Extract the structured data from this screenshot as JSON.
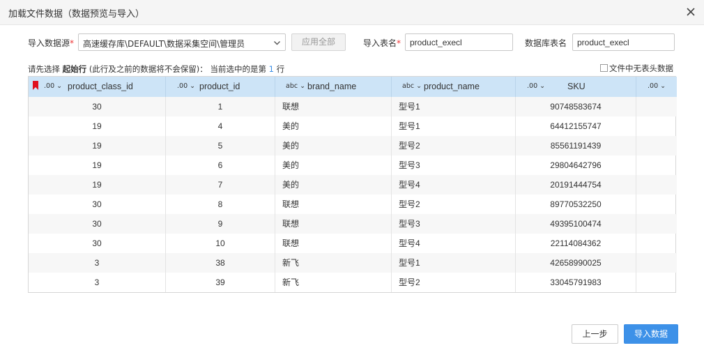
{
  "dialog": {
    "title": "加载文件数据（数据预览与导入）"
  },
  "form": {
    "datasource_label": "导入数据源",
    "datasource_value": "高速缓存库\\DEFAULT\\数据采集空间\\管理员",
    "apply_all_label": "应用全部",
    "import_table_label": "导入表名",
    "import_table_value": "product_execl",
    "db_table_label": "数据库表名",
    "db_table_value": "product_execl",
    "required_mark": "*"
  },
  "hint": {
    "prefix": "请先选择",
    "bold": "起始行",
    "middle": "(此行及之前的数据将不会保留)：  当前选中的是第",
    "row_number": "1",
    "suffix": "行",
    "no_header_label": "文件中无表头数据"
  },
  "table": {
    "columns": [
      {
        "type": ".00",
        "name": "product_class_id"
      },
      {
        "type": ".00",
        "name": "product_id"
      },
      {
        "type": "abc",
        "name": "brand_name"
      },
      {
        "type": "abc",
        "name": "product_name"
      },
      {
        "type": ".00",
        "name": "SKU"
      },
      {
        "type": ".00",
        "name": ""
      }
    ],
    "rows": [
      [
        "30",
        "1",
        "联想",
        "型号1",
        "90748583674",
        ""
      ],
      [
        "19",
        "4",
        "美的",
        "型号1",
        "64412155747",
        ""
      ],
      [
        "19",
        "5",
        "美的",
        "型号2",
        "85561191439",
        ""
      ],
      [
        "19",
        "6",
        "美的",
        "型号3",
        "29804642796",
        ""
      ],
      [
        "19",
        "7",
        "美的",
        "型号4",
        "20191444754",
        ""
      ],
      [
        "30",
        "8",
        "联想",
        "型号2",
        "89770532250",
        ""
      ],
      [
        "30",
        "9",
        "联想",
        "型号3",
        "49395100474",
        ""
      ],
      [
        "30",
        "10",
        "联想",
        "型号4",
        "22114084362",
        ""
      ],
      [
        "3",
        "38",
        "新飞",
        "型号1",
        "42658990025",
        ""
      ],
      [
        "3",
        "39",
        "新飞",
        "型号2",
        "33045791983",
        ""
      ]
    ]
  },
  "footer": {
    "prev_label": "上一步",
    "import_label": "导入数据"
  },
  "colors": {
    "accent": "#3d91e8",
    "header_bg": "#cde4f7",
    "flag": "#e0101e"
  }
}
